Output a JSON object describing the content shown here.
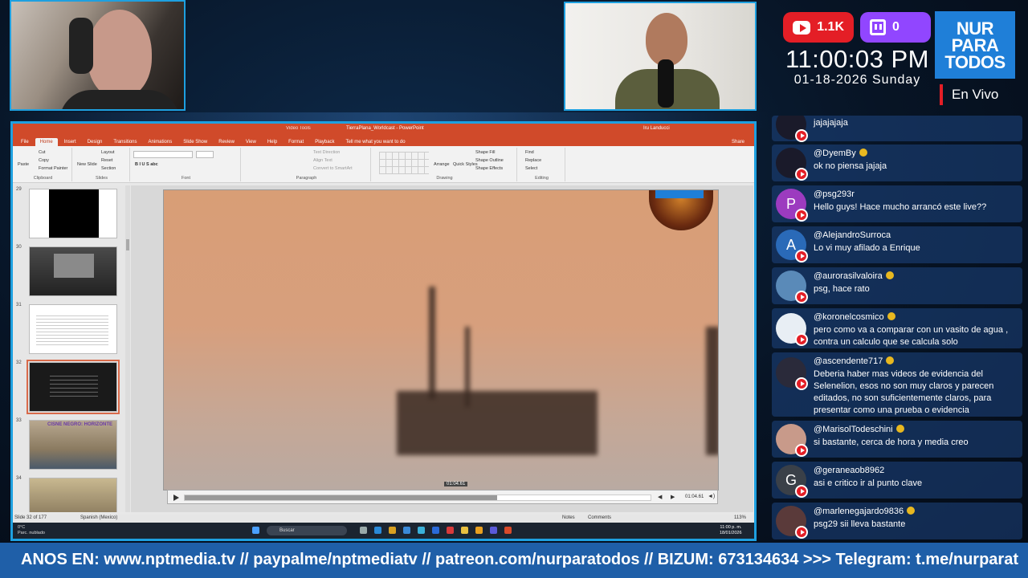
{
  "stats": {
    "youtube_count": "1.1K",
    "twitch_count": "0"
  },
  "clock": {
    "time": "11:00:03 PM",
    "date": "01-18-2026 Sunday"
  },
  "brand": {
    "line1": "NUR",
    "line2": "PARA",
    "line3": "TODOS"
  },
  "live_label": "En Vivo",
  "ppt": {
    "title": "TierraPlana_Worldcast - PowerPoint",
    "tools": "Video Tools",
    "user": "Iru Landucci",
    "tabs": [
      "File",
      "Home",
      "Insert",
      "Design",
      "Transitions",
      "Animations",
      "Slide Show",
      "Review",
      "View",
      "Help",
      "Format",
      "Playback",
      "Tell me what you want to do"
    ],
    "share": "Share",
    "ribbon": {
      "paste": "Paste",
      "cut": "Cut",
      "copy": "Copy",
      "format_painter": "Format Painter",
      "clipboard": "Clipboard",
      "new_slide": "New Slide",
      "layout": "Layout",
      "reset": "Reset",
      "section": "Section",
      "slides": "Slides",
      "font": "Font",
      "paragraph": "Paragraph",
      "text_direction": "Text Direction",
      "align_text": "Align Text",
      "convert_smartart": "Convert to SmartArt",
      "arrange": "Arrange",
      "quick_styles": "Quick Styles",
      "shape_fill": "Shape Fill",
      "shape_outline": "Shape Outline",
      "shape_effects": "Shape Effects",
      "drawing": "Drawing",
      "find": "Find",
      "replace": "Replace",
      "select": "Select",
      "editing": "Editing"
    },
    "slide_numbers": [
      "29",
      "30",
      "31",
      "32",
      "33",
      "34"
    ],
    "thumb_caption_33": "CISNE NEGRO: HORIZONTE",
    "video_time_tip": "01:04.61",
    "video_time": "01:04.61",
    "video_progress": 0.67,
    "status": {
      "slide": "Slide 32 of 177",
      "language": "Spanish (Mexico)",
      "notes": "Notes",
      "comments": "Comments",
      "zoom": "113%"
    },
    "taskbar": {
      "search": "Buscar",
      "temp": "0°C",
      "weather": "Parc. nublado",
      "time": "11:00 p. m.",
      "date": "18/01/2026"
    }
  },
  "chat": [
    {
      "name": "",
      "text": "jajajajaja",
      "avatar_letter": "",
      "avatar_color": "#1a1a2a",
      "star": false
    },
    {
      "name": "@DyemBy",
      "text": "ok no piensa jajaja",
      "avatar_letter": "",
      "avatar_color": "#1a1a2a",
      "star": true
    },
    {
      "name": "@psg293r",
      "text": "Hello guys! Hace mucho arrancó este live??",
      "avatar_letter": "P",
      "avatar_color": "#9c3bbf",
      "star": false
    },
    {
      "name": "@AlejandroSurroca",
      "text": "Lo vi muy afilado a Enrique",
      "avatar_letter": "A",
      "avatar_color": "#2a6ab8",
      "star": false
    },
    {
      "name": "@aurorasilvaloira",
      "text": "psg, hace rato",
      "avatar_letter": "",
      "avatar_color": "#5a8ab8",
      "star": true
    },
    {
      "name": "@koronelcosmico",
      "text": "pero como va a comparar con un vasito de agua , contra un calculo que se calcula solo",
      "avatar_letter": "",
      "avatar_color": "#e8eef4",
      "star": true
    },
    {
      "name": "@ascendente717",
      "text": "Deberia haber mas videos de evidencia del Selenelion, esos no son muy claros y parecen editados, no son suficientemente claros, para presentar como una prueba o evidencia",
      "avatar_letter": "",
      "avatar_color": "#2a2a3a",
      "star": true
    },
    {
      "name": "@MarisolTodeschini",
      "text": "si bastante, cerca de hora y media creo",
      "avatar_letter": "",
      "avatar_color": "#c89a8a",
      "star": true
    },
    {
      "name": "@geraneaob8962",
      "text": "asi e critico ir al punto clave",
      "avatar_letter": "G",
      "avatar_color": "#3a4048",
      "star": false
    },
    {
      "name": "@marlenegajardo9836",
      "text": "psg29 sii lleva bastante",
      "avatar_letter": "",
      "avatar_color": "#5a3a3a",
      "star": true
    }
  ],
  "ticker": "ANOS EN: www.nptmedia.tv // paypalme/nptmediatv // patreon.com/nurparatodos // BIZUM: 673134634 >>> Telegram: t.me/nurparat"
}
